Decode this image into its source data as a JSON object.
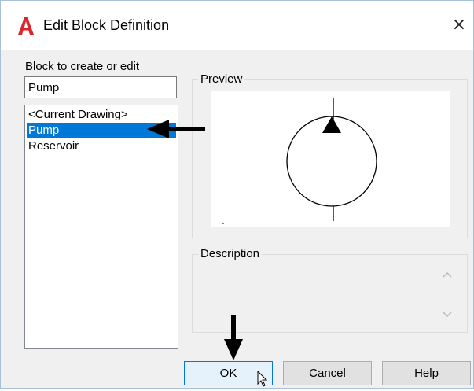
{
  "window": {
    "title": "Edit Block Definition",
    "close_glyph": "×"
  },
  "form": {
    "block_label": "Block to create or edit",
    "block_value": "Pump",
    "list_items": [
      "<Current Drawing>",
      "Pump",
      "Reservoir"
    ],
    "selected_item": "Pump",
    "preview_label": "Preview",
    "description_label": "Description",
    "description_value": ""
  },
  "buttons": {
    "ok": "OK",
    "cancel": "Cancel",
    "help": "Help"
  },
  "icons": {
    "app": "autocad-a-icon",
    "close": "close-icon",
    "scroll_up": "chevron-up-icon",
    "scroll_down": "chevron-down-icon",
    "annotation_arrow_left": "arrow-left-icon",
    "annotation_arrow_down": "arrow-down-icon",
    "pointer": "mouse-pointer-icon"
  },
  "colors": {
    "brand": "#d8282e",
    "selection": "#0078d7",
    "default_button_border": "#0078d7"
  }
}
